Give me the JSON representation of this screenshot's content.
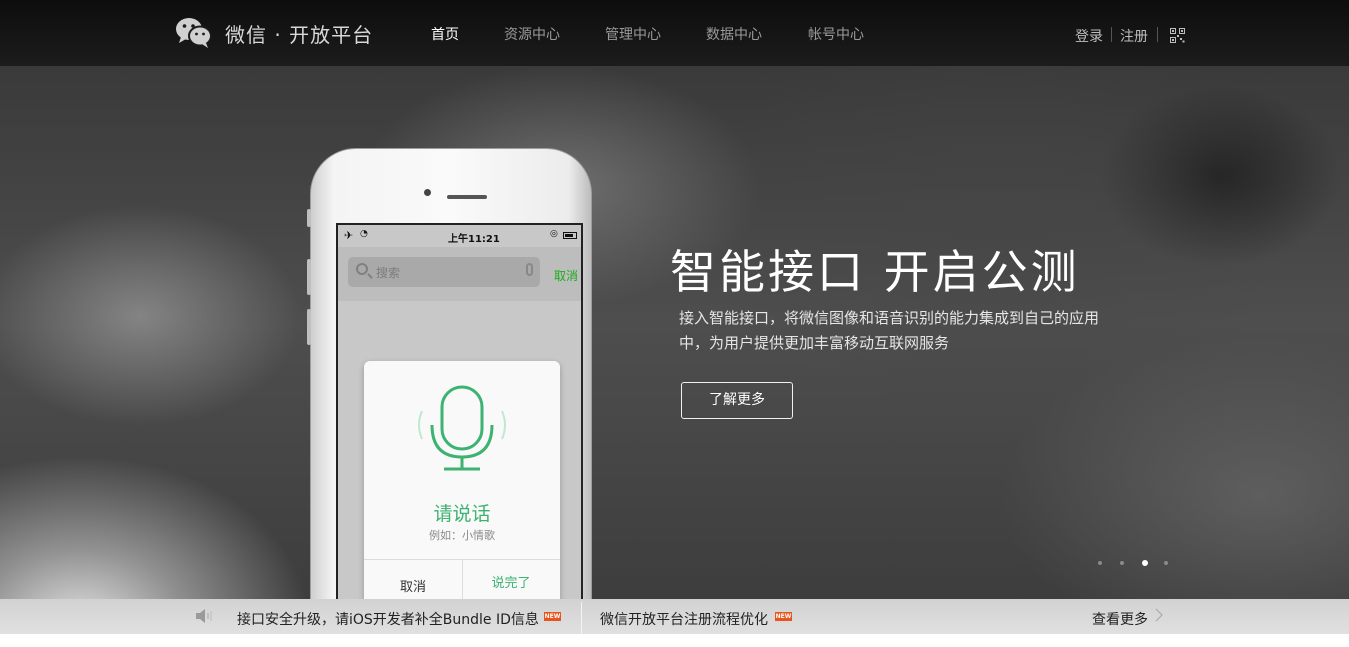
{
  "header": {
    "logo_text": "微信 · 开放平台",
    "nav": [
      {
        "label": "首页",
        "active": true
      },
      {
        "label": "资源中心",
        "active": false
      },
      {
        "label": "管理中心",
        "active": false
      },
      {
        "label": "数据中心",
        "active": false
      },
      {
        "label": "帐号中心",
        "active": false
      }
    ],
    "login": "登录",
    "register": "注册",
    "qr_icon": "qrcode-icon"
  },
  "hero": {
    "title": "智能接口  开启公测",
    "description": "接入智能接口，将微信图像和语音识别的能力集成到自己的应用中，为用户提供更加丰富移动互联网服务",
    "button": "了解更多",
    "carousel": {
      "total": 4,
      "active_index": 2
    },
    "phone": {
      "status_time": "上午11:21",
      "search_placeholder": "搜索",
      "search_cancel": "取消",
      "voice_prompt": "请说话",
      "voice_example": "例如：小情歌",
      "btn_cancel": "取消",
      "btn_done": "说完了"
    }
  },
  "news": {
    "items": [
      {
        "text": "接口安全升级，请iOS开发者补全Bundle ID信息",
        "badge": "NEW"
      },
      {
        "text": "微信开放平台注册流程优化",
        "badge": "NEW"
      }
    ],
    "more": "查看更多"
  },
  "colors": {
    "accent_green": "#3cb371",
    "wechat_green": "#1aad19",
    "badge_orange": "#e8541e",
    "topbar": "#111111"
  }
}
